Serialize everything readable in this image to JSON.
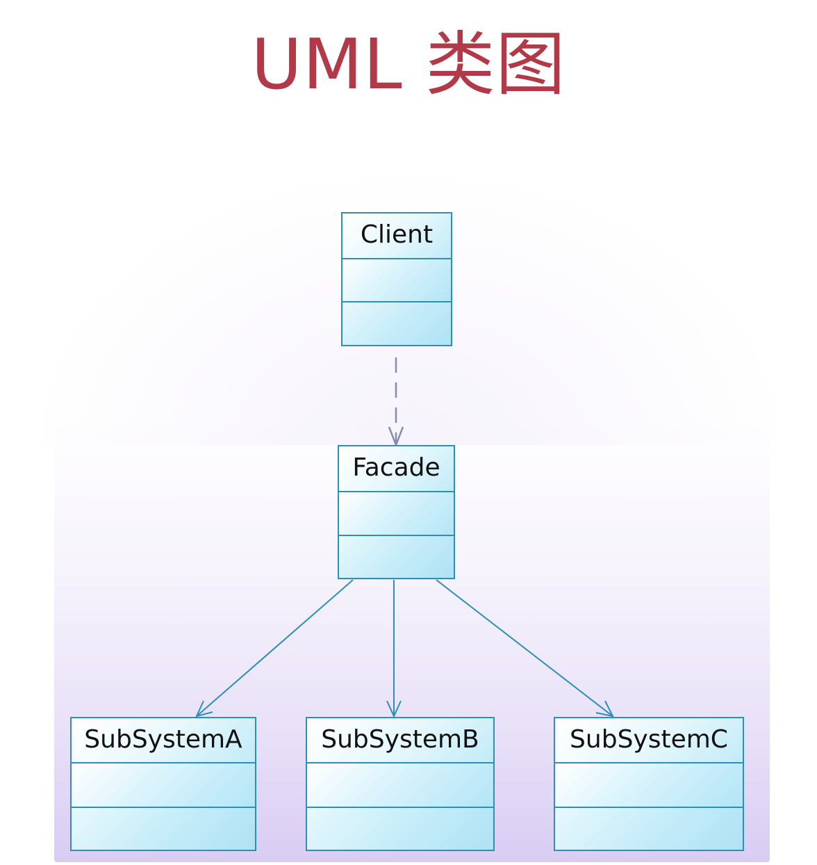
{
  "title": "UML 类图",
  "colors": {
    "title": "#b23a48",
    "class_border": "#2f8fae",
    "class_fill": "#c4ecf9",
    "connector": "#2a8fb5",
    "dependency": "#8a8ab0"
  },
  "classes": {
    "client": {
      "name": "Client"
    },
    "facade": {
      "name": "Facade"
    },
    "subsystem_a": {
      "name": "SubSystemA"
    },
    "subsystem_b": {
      "name": "SubSystemB"
    },
    "subsystem_c": {
      "name": "SubSystemC"
    }
  },
  "relations": [
    {
      "from": "Client",
      "to": "Facade",
      "kind": "dependency"
    },
    {
      "from": "Facade",
      "to": "SubSystemA",
      "kind": "association"
    },
    {
      "from": "Facade",
      "to": "SubSystemB",
      "kind": "association"
    },
    {
      "from": "Facade",
      "to": "SubSystemC",
      "kind": "association"
    }
  ]
}
